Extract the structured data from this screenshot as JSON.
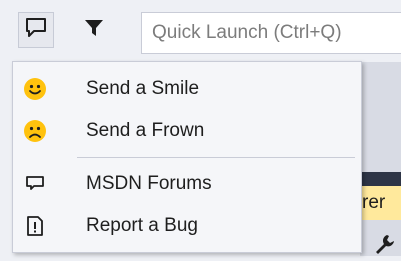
{
  "toolbar": {
    "feedback_icon": "speech-bubble-icon",
    "filter_icon": "funnel-icon",
    "quick_launch_placeholder": "Quick Launch (Ctrl+Q)"
  },
  "background": {
    "tab_text": "rer",
    "tab_color": "#ffe99c",
    "wrench_icon": "wrench-icon"
  },
  "menu": {
    "items": [
      {
        "label": "Send a Smile",
        "icon": "smiley-icon",
        "icon_color": "#ffc20e"
      },
      {
        "label": "Send a Frown",
        "icon": "frown-icon",
        "icon_color": "#ffc20e"
      },
      {
        "label": "MSDN Forums",
        "icon": "forum-bubble-icon"
      },
      {
        "label": "Report a Bug",
        "icon": "bug-report-icon"
      }
    ]
  }
}
